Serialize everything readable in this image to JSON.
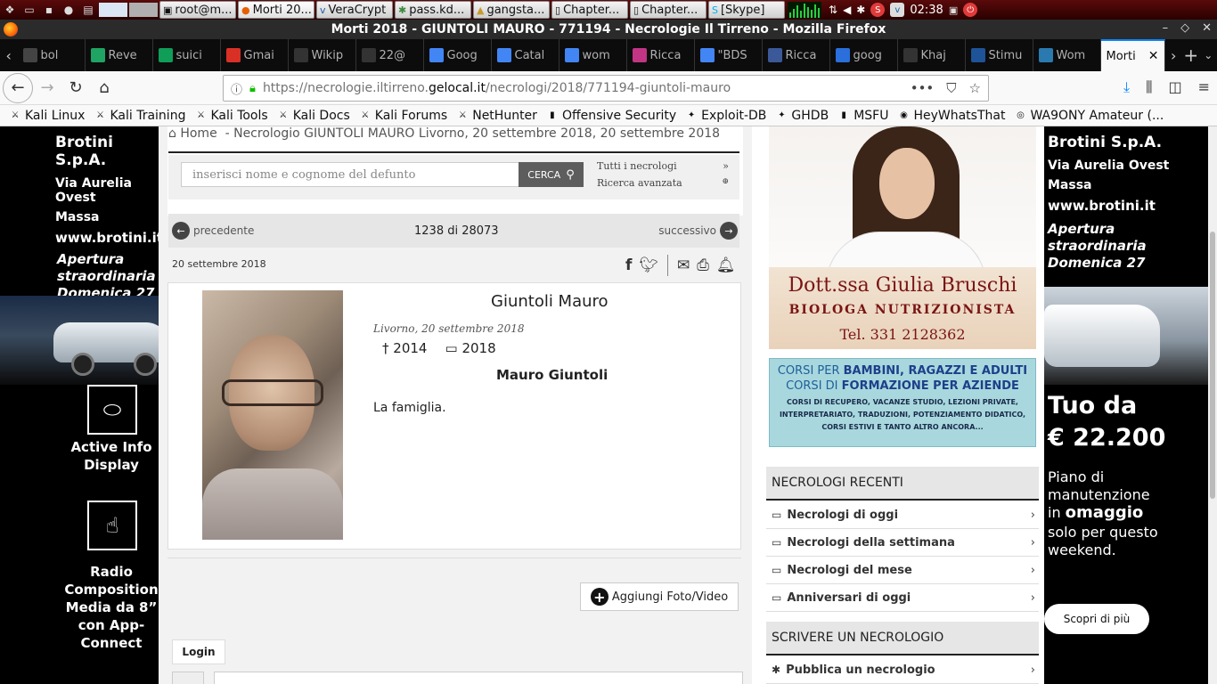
{
  "taskbar": {
    "tasks": [
      {
        "label": "root@m...",
        "icon": "terminal-icon"
      },
      {
        "label": "Morti 20...",
        "icon": "firefox-icon"
      },
      {
        "label": "VeraCrypt",
        "icon": "veracrypt-icon"
      },
      {
        "label": "pass.kd...",
        "icon": "keepass-icon"
      },
      {
        "label": "gangsta...",
        "icon": "folder-icon"
      },
      {
        "label": "Chapter...",
        "icon": "document-icon"
      },
      {
        "label": "Chapter...",
        "icon": "document-icon"
      },
      {
        "label": "[Skype]",
        "icon": "skype-icon"
      }
    ],
    "clock": "02:38"
  },
  "window": {
    "title": "Morti 2018 - GIUNTOLI MAURO - 771194 - Necrologie Il Tirreno - Mozilla Firefox"
  },
  "tabs": [
    {
      "label": "bol",
      "icon": "site-icon",
      "color": "#444"
    },
    {
      "label": "Reve",
      "icon": "drive-icon",
      "color": "#1fa463"
    },
    {
      "label": "suici",
      "icon": "plus-icon",
      "color": "#0f9d58"
    },
    {
      "label": "Gmai",
      "icon": "gmail-icon",
      "color": "#d93025"
    },
    {
      "label": "Wikip",
      "icon": "wikipedia-icon",
      "color": "#333"
    },
    {
      "label": "22@",
      "icon": "wikipedia-icon",
      "color": "#333"
    },
    {
      "label": "Goog",
      "icon": "translate-icon",
      "color": "#4285f4"
    },
    {
      "label": "Catal",
      "icon": "google-icon",
      "color": "#4285f4"
    },
    {
      "label": "wom",
      "icon": "google-icon",
      "color": "#4285f4"
    },
    {
      "label": "Ricca",
      "icon": "instagram-icon",
      "color": "#c13584"
    },
    {
      "label": "\"BDS",
      "icon": "google-icon",
      "color": "#4285f4"
    },
    {
      "label": "Ricca",
      "icon": "facebook-icon",
      "color": "#3b5998"
    },
    {
      "label": "goog",
      "icon": "globe-icon",
      "color": "#2a6fdb"
    },
    {
      "label": "Khaj",
      "icon": "wikipedia-icon",
      "color": "#333"
    },
    {
      "label": "Stimu",
      "icon": "stackexchange-icon",
      "color": "#1e5397"
    },
    {
      "label": "Wom",
      "icon": "link-icon",
      "color": "#2a7ab0"
    },
    {
      "label": "Morti",
      "icon": "none",
      "color": "#fff"
    }
  ],
  "nav": {
    "url_prefix": "https://necrologie.iltirreno.",
    "url_domain": "gelocal.it",
    "url_path": "/necrologi/2018/771194-giuntoli-mauro"
  },
  "bookmarks": [
    {
      "label": "Kali Linux",
      "icon": "kali-icon"
    },
    {
      "label": "Kali Training",
      "icon": "kali-icon"
    },
    {
      "label": "Kali Tools",
      "icon": "kali-icon"
    },
    {
      "label": "Kali Docs",
      "icon": "kali-icon"
    },
    {
      "label": "Kali Forums",
      "icon": "kali-icon"
    },
    {
      "label": "NetHunter",
      "icon": "kali-icon"
    },
    {
      "label": "Offensive Security",
      "icon": "offsec-icon"
    },
    {
      "label": "Exploit-DB",
      "icon": "exploitdb-icon"
    },
    {
      "label": "GHDB",
      "icon": "exploitdb-icon"
    },
    {
      "label": "MSFU",
      "icon": "offsec-icon"
    },
    {
      "label": "HeyWhatsThat",
      "icon": "heywhatsthat-icon"
    },
    {
      "label": "WA9ONY Amateur (...",
      "icon": "wa9ony-icon"
    }
  ],
  "ad_left": {
    "brand": "Brotini S.p.A.",
    "address1": "Via Aurelia Ovest",
    "address2": "Massa",
    "site": "www.brotini.it",
    "headline": [
      "Apertura",
      "straordinaria",
      "Domenica 27"
    ],
    "feature1": "Active Info Display",
    "feature2": "Radio Composition Media da 8” con App-Connect"
  },
  "ad_right": {
    "brand": "Brotini S.p.A.",
    "address1": "Via Aurelia Ovest",
    "address2": "Massa",
    "site": "www.brotini.it",
    "headline": [
      "Apertura",
      "straordinaria",
      "Domenica 27"
    ],
    "price_line1": "Tuo da",
    "price_line2": "€ 22.200",
    "offer1": "Piano di",
    "offer2": "manutenzione",
    "offer3_pre": "in ",
    "offer3_bold": "omaggio",
    "offer4": "solo per questo",
    "offer5": "weekend.",
    "cta": "Scopri di più"
  },
  "page": {
    "breadcrumb_home": "Home",
    "breadcrumb_rest": "- Necrologio GIUNTOLI MAURO Livorno, 20 settembre 2018, 20 settembre 2018",
    "search_placeholder": "inserisci nome e cognome del defunto",
    "search_button": "CERCA",
    "link_all": "Tutti i necrologi",
    "link_advanced": "Ricerca avanzata",
    "pager_prev": "precedente",
    "pager_count": "1238 di 28073",
    "pager_next": "successivo",
    "date": "20 settembre 2018",
    "deceased_name": "Giuntoli Mauro",
    "place_date": "Livorno, 20 settembre 2018",
    "year_death": "2014",
    "year_pub": "2018",
    "signature": "Mauro Giuntoli",
    "text": "La famiglia.",
    "add_media": "Aggiungi Foto/Video",
    "login": "Login"
  },
  "sidebar": {
    "bio_name": "Dott.ssa Giulia Bruschi",
    "bio_role": "BIOLOGA NUTRIZIONISTA",
    "bio_tel": "Tel. 331 2128362",
    "corsi_1a": "CORSI PER ",
    "corsi_1b": "BAMBINI, RAGAZZI E ADULTI",
    "corsi_2a": "CORSI DI ",
    "corsi_2b": "FORMAZIONE PER AZIENDE",
    "corsi_small1": "CORSI DI RECUPERO, VACANZE STUDIO, LEZIONI PRIVATE,",
    "corsi_small2": "INTERPRETARIATO, TRADUZIONI, POTENZIAMENTO DIDATICO,",
    "corsi_small3": "CORSI ESTIVI E TANTO ALTRO ANCORA...",
    "recent_header": "NECROLOGI RECENTI",
    "recent": [
      "Necrologi di oggi",
      "Necrologi della settimana",
      "Necrologi del mese",
      "Anniversari di oggi"
    ],
    "write_header": "SCRIVERE UN NECROLOGIO",
    "write_item": "Pubblica un necrologio"
  }
}
